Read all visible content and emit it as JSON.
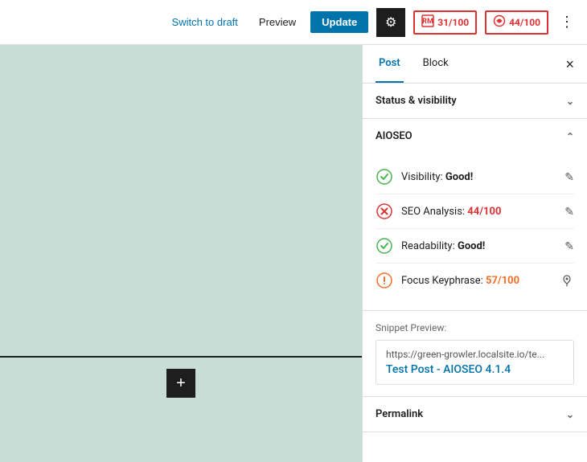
{
  "toolbar": {
    "switch_draft_label": "Switch to draft",
    "preview_label": "Preview",
    "update_label": "Update",
    "gear_icon": "⚙",
    "seo_score_icon": "✕",
    "seo_score_value": "31/100",
    "readability_icon": "◎",
    "readability_value": "44/100",
    "more_icon": "⋮"
  },
  "sidebar": {
    "tab_post_label": "Post",
    "tab_block_label": "Block",
    "close_icon": "×",
    "sections": {
      "status_visibility": {
        "label": "Status & visibility",
        "expanded": false
      },
      "aioseo": {
        "label": "AIOSEO",
        "expanded": true,
        "items": [
          {
            "icon_type": "green-check",
            "label": "Visibility: ",
            "label_bold": "Good!",
            "score": null,
            "score_color": null
          },
          {
            "icon_type": "red-x",
            "label": "SEO Analysis: ",
            "label_bold": null,
            "score": "44/100",
            "score_color": "red"
          },
          {
            "icon_type": "green-check",
            "label": "Readability: ",
            "label_bold": "Good!",
            "score": null,
            "score_color": null
          },
          {
            "icon_type": "orange-info",
            "label": "Focus Keyphrase: ",
            "label_bold": null,
            "score": "57/100",
            "score_color": "orange"
          }
        ]
      },
      "snippet_preview": {
        "label": "Snippet Preview:",
        "url": "https://green-growler.localsite.io/te...",
        "title": "Test Post - AIOSEO 4.1.4"
      },
      "permalink": {
        "label": "Permalink",
        "expanded": false
      }
    }
  },
  "canvas": {
    "add_icon": "+"
  }
}
